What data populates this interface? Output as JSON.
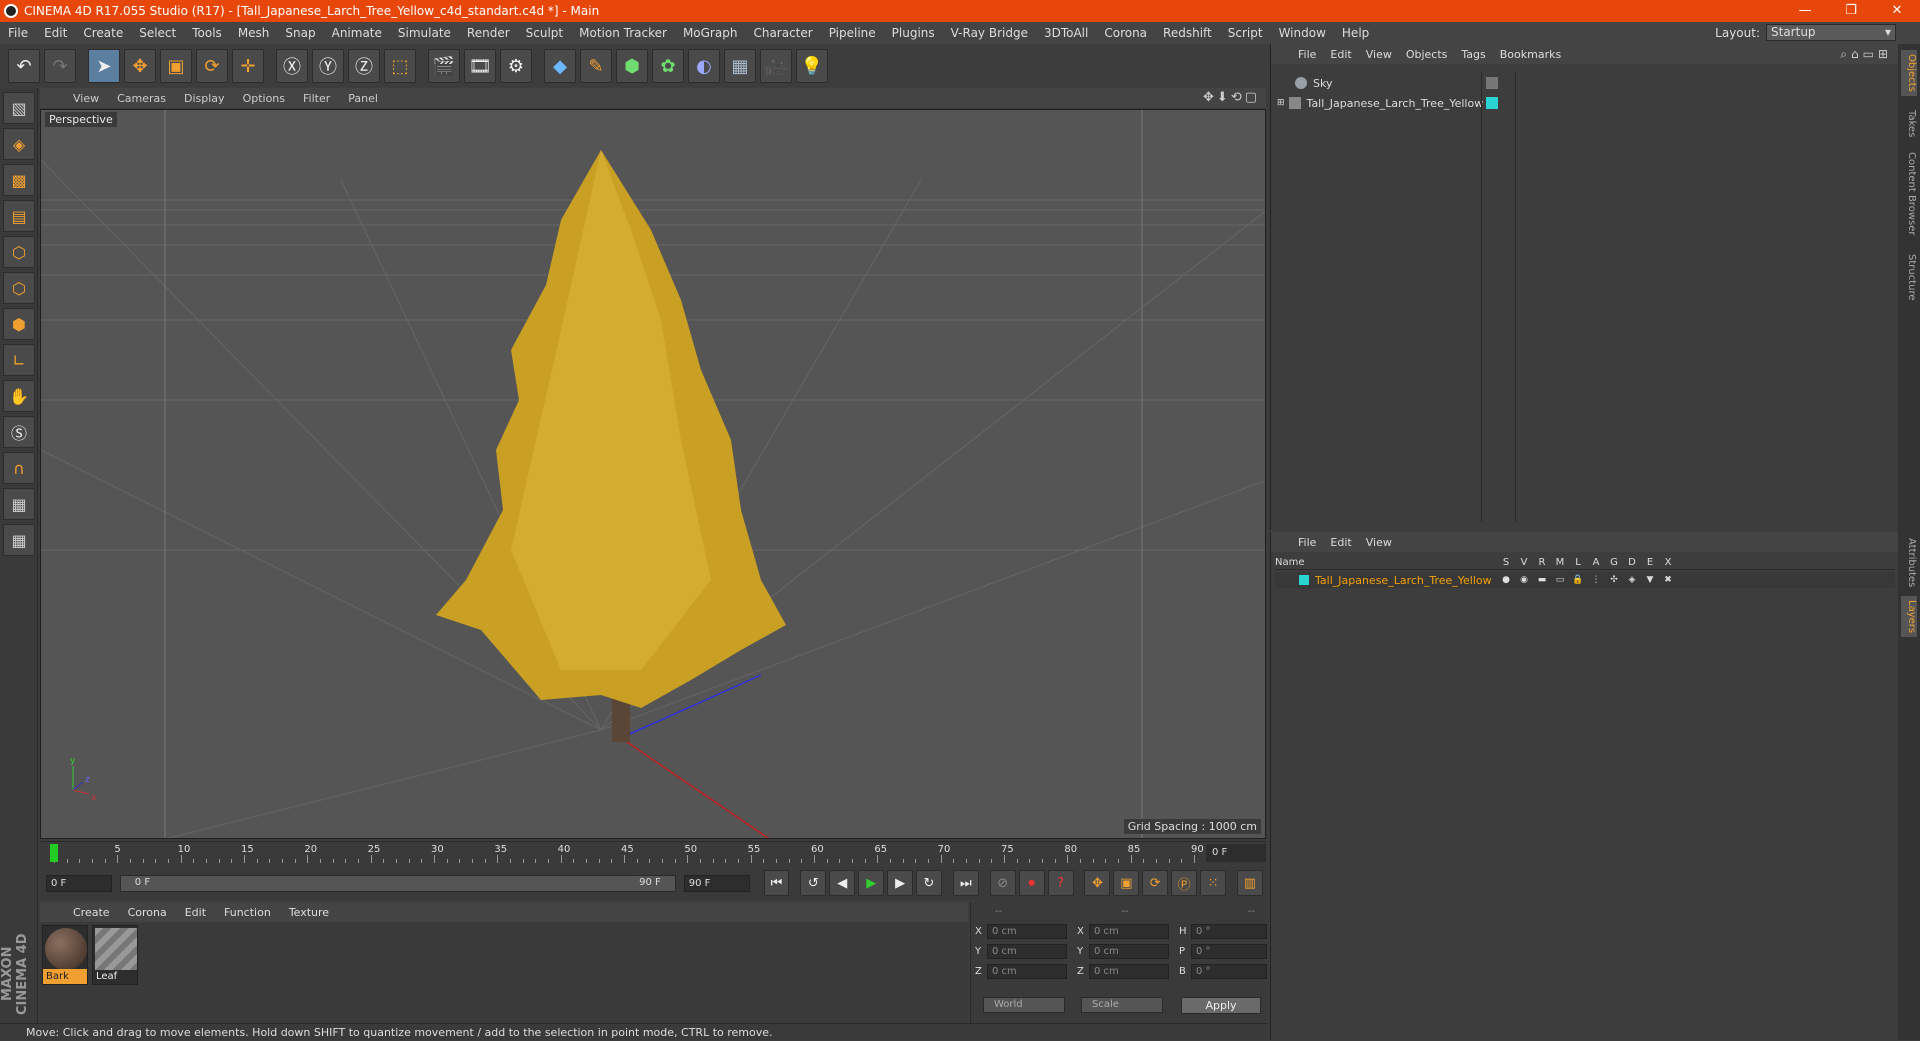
{
  "window": {
    "title": "CINEMA 4D R17.055 Studio (R17) - [Tall_Japanese_Larch_Tree_Yellow_c4d_standart.c4d *] - Main",
    "min": "—",
    "max": "❐",
    "close": "✕"
  },
  "menu": [
    "File",
    "Edit",
    "Create",
    "Select",
    "Tools",
    "Mesh",
    "Snap",
    "Animate",
    "Simulate",
    "Render",
    "Sculpt",
    "Motion Tracker",
    "MoGraph",
    "Character",
    "Pipeline",
    "Plugins",
    "V-Ray Bridge",
    "3DToAll",
    "Corona",
    "Redshift",
    "Script",
    "Window",
    "Help"
  ],
  "layout": {
    "label": "Layout:",
    "value": "Startup"
  },
  "viewport": {
    "menu": [
      "View",
      "Cameras",
      "Display",
      "Options",
      "Filter",
      "Panel"
    ],
    "label": "Perspective",
    "grid_spacing": "Grid Spacing : 1000 cm",
    "nav_icons": "✥⬇⟲▢"
  },
  "timeline": {
    "ticks": [
      "0",
      "5",
      "10",
      "15",
      "20",
      "25",
      "30",
      "35",
      "40",
      "45",
      "50",
      "55",
      "60",
      "65",
      "70",
      "75",
      "80",
      "85",
      "90"
    ],
    "current_frame": "0 F",
    "start": "0 F",
    "range_start": "0 F",
    "range_end": "90 F",
    "end": "90 F"
  },
  "materials": {
    "menu": [
      "Create",
      "Corona",
      "Edit",
      "Function",
      "Texture"
    ],
    "items": [
      {
        "name": "Bark",
        "color": "#5a4a3a"
      },
      {
        "name": "Leaf",
        "color": "#8a8a8a"
      }
    ]
  },
  "coords": {
    "header": [
      "--",
      "--",
      "--"
    ],
    "rows": [
      {
        "a1": "X",
        "v1": "0 cm",
        "a2": "X",
        "v2": "0 cm",
        "a3": "H",
        "v3": "0 °"
      },
      {
        "a1": "Y",
        "v1": "0 cm",
        "a2": "Y",
        "v2": "0 cm",
        "a3": "P",
        "v3": "0 °"
      },
      {
        "a1": "Z",
        "v1": "0 cm",
        "a2": "Z",
        "v2": "0 cm",
        "a3": "B",
        "v3": "0 °"
      }
    ],
    "space": "World",
    "mode": "Scale",
    "apply": "Apply"
  },
  "objects": {
    "menu": [
      "File",
      "Edit",
      "View",
      "Objects",
      "Tags",
      "Bookmarks"
    ],
    "items": [
      {
        "name": "Sky",
        "color": "#9aa0a8"
      },
      {
        "name": "Tall_Japanese_Larch_Tree_Yellow",
        "color": "#2ad4d4"
      }
    ]
  },
  "layers": {
    "menu": [
      "File",
      "Edit",
      "View"
    ],
    "header_name": "Name",
    "header_cols": [
      "S",
      "V",
      "R",
      "M",
      "L",
      "A",
      "G",
      "D",
      "E",
      "X"
    ],
    "row_name": "Tall_Japanese_Larch_Tree_Yellow"
  },
  "right_tabs": [
    "Objects",
    "Takes",
    "Content Browser",
    "Structure",
    "Attributes",
    "Layers"
  ],
  "status": "Move: Click and drag to move elements. Hold down SHIFT to quantize movement / add to the selection in point mode, CTRL to remove.",
  "brand": "MAXON CINEMA 4D"
}
